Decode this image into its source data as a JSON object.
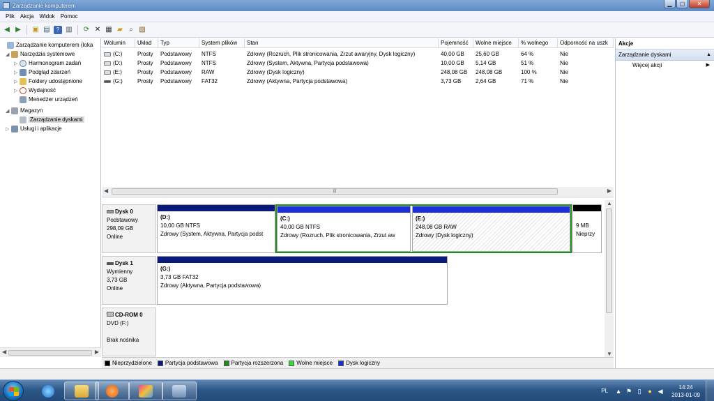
{
  "window": {
    "title": "Zarządzanie komputerem"
  },
  "menu": [
    "Plik",
    "Akcja",
    "Widok",
    "Pomoc"
  ],
  "tree": {
    "items": [
      {
        "label": "Zarządzanie komputerem (loka",
        "level": 0,
        "arrow": "",
        "icon": "computer-icon"
      },
      {
        "label": "Narzędzia systemowe",
        "level": 1,
        "arrow": "◢",
        "icon": "tools-icon"
      },
      {
        "label": "Harmonogram zadań",
        "level": 2,
        "arrow": "▷",
        "icon": "clock-icon"
      },
      {
        "label": "Podgląd zdarzeń",
        "level": 2,
        "arrow": "▷",
        "icon": "event-viewer-icon"
      },
      {
        "label": "Foldery udostępnione",
        "level": 2,
        "arrow": "▷",
        "icon": "shared-folder-icon"
      },
      {
        "label": "Wydajność",
        "level": 2,
        "arrow": "▷",
        "icon": "performance-icon"
      },
      {
        "label": "Menedżer urządzeń",
        "level": 2,
        "arrow": "",
        "icon": "device-manager-icon"
      },
      {
        "label": "Magazyn",
        "level": 1,
        "arrow": "◢",
        "icon": "storage-icon"
      },
      {
        "label": "Zarządzanie dyskami",
        "level": 2,
        "arrow": "",
        "icon": "disk-management-icon",
        "selected": true
      },
      {
        "label": "Usługi i aplikacje",
        "level": 1,
        "arrow": "▷",
        "icon": "services-icon"
      }
    ]
  },
  "volumes": {
    "headers": [
      "Wolumin",
      "Układ",
      "Typ",
      "System plików",
      "Stan",
      "Pojemność",
      "Wolne miejsce",
      "% wolnego",
      "Odporność na uszk"
    ],
    "rows": [
      [
        "(C:)",
        "Prosty",
        "Podstawowy",
        "NTFS",
        "Zdrowy (Rozruch, Plik stronicowania, Zrzut awaryjny, Dysk logiczny)",
        "40,00 GB",
        "25,60 GB",
        "64 %",
        "Nie"
      ],
      [
        "(D:)",
        "Prosty",
        "Podstawowy",
        "NTFS",
        "Zdrowy (System, Aktywna, Partycja podstawowa)",
        "10,00 GB",
        "5,14 GB",
        "51 %",
        "Nie"
      ],
      [
        "(E:)",
        "Prosty",
        "Podstawowy",
        "RAW",
        "Zdrowy (Dysk logiczny)",
        "248,08 GB",
        "248,08 GB",
        "100 %",
        "Nie"
      ],
      [
        "(G:)",
        "Prosty",
        "Podstawowy",
        "FAT32",
        "Zdrowy (Aktywna, Partycja podstawowa)",
        "3,73 GB",
        "2,64 GB",
        "71 %",
        "Nie"
      ]
    ]
  },
  "disks": {
    "disk0": {
      "name": "Dysk 0",
      "type": "Podstawowy",
      "size": "298,09 GB",
      "status": "Online",
      "partitions": [
        {
          "title": "(D:)",
          "size": "10,00 GB NTFS",
          "status": "Zdrowy (System, Aktywna, Partycja podst"
        },
        {
          "title": "(C:)",
          "size": "40,00 GB NTFS",
          "status": "Zdrowy (Rozruch, Plik stronicowania, Zrzut aw"
        },
        {
          "title": "(E:)",
          "size": "248,08 GB RAW",
          "status": "Zdrowy (Dysk logiczny)"
        },
        {
          "title": "",
          "size": "9 MB",
          "status": "Nieprzy"
        }
      ]
    },
    "disk1": {
      "name": "Dysk 1",
      "type": "Wymienny",
      "size": "3,73 GB",
      "status": "Online",
      "partitions": [
        {
          "title": "(G:)",
          "size": "3,73 GB FAT32",
          "status": "Zdrowy (Aktywna, Partycja podstawowa)"
        }
      ]
    },
    "cdrom0": {
      "name": "CD-ROM 0",
      "type": "DVD (F:)",
      "status": "Brak nośnika"
    }
  },
  "legend": [
    {
      "label": "Nieprzydzielone",
      "color": "#000000"
    },
    {
      "label": "Partycja podstawowa",
      "color": "#0a1a7a"
    },
    {
      "label": "Partycja rozszerzona",
      "color": "#1f8c1f"
    },
    {
      "label": "Wolne miejsce",
      "color": "#33dd33"
    },
    {
      "label": "Dysk logiczny",
      "color": "#1a2fd6"
    }
  ],
  "actions": {
    "header": "Akcje",
    "section": "Zarządzanie dyskami",
    "more": "Więcej akcji"
  },
  "taskbar": {
    "lang": "PL",
    "time": "14:24",
    "date": "2013-01-09",
    "apps": [
      "internet-explorer-icon",
      "explorer-icon",
      "media-player-icon",
      "app-icon",
      "computer-management-icon"
    ]
  },
  "colors": {
    "primary_partition": "#0a1a7a",
    "logical_drive": "#1a2fd6",
    "extended_partition": "#1f8c1f",
    "unallocated": "#000000"
  }
}
